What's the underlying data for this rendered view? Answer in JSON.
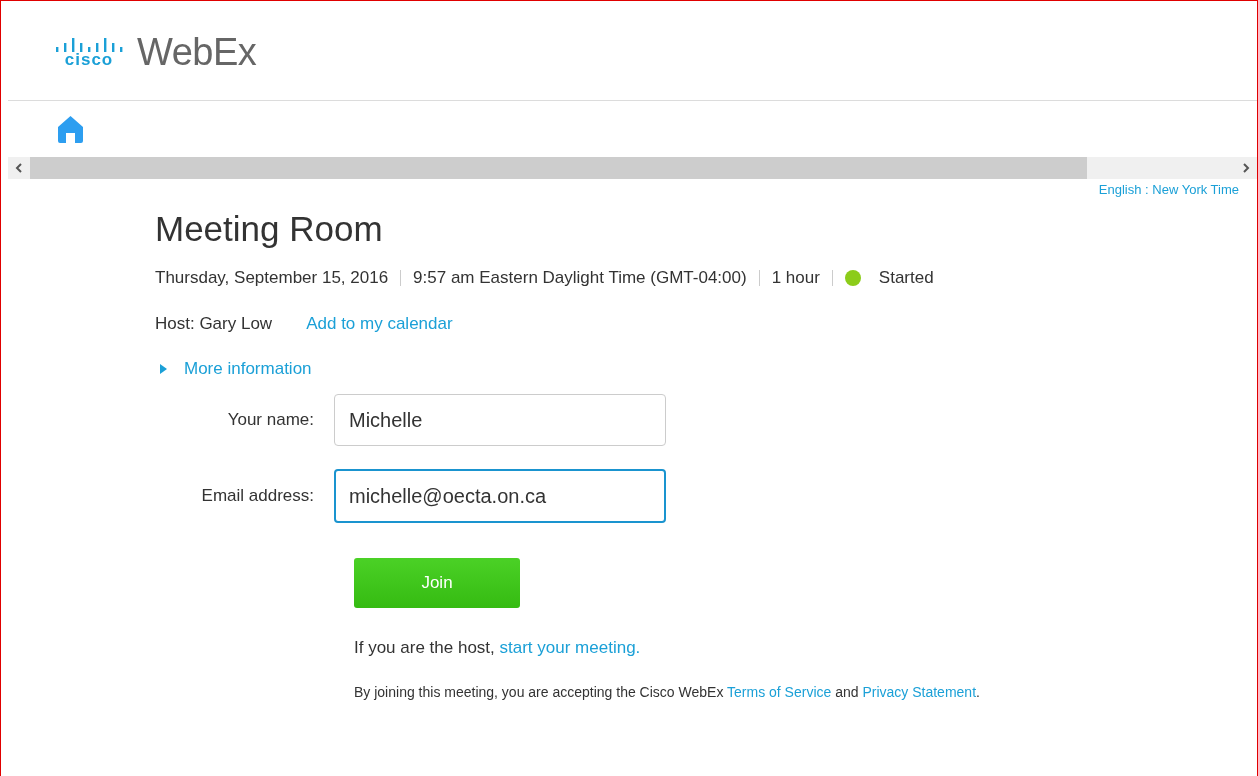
{
  "header": {
    "logo_mark": "cisco",
    "product": "WebEx"
  },
  "locale": "English : New York Time",
  "meeting": {
    "title": "Meeting Room",
    "details": [
      "Thursday, September 15, 2016",
      "9:57 am Eastern Daylight Time (GMT-04:00)",
      "1 hour"
    ],
    "status": {
      "label": "Started",
      "color": "#8ccc1a"
    },
    "host": "Host: Gary Low",
    "calendar_link": "Add to my calendar",
    "more_info": {
      "label": "More information",
      "expanded": false
    }
  },
  "form": {
    "fields": [
      {
        "label": "Your name:",
        "value": "Michelle",
        "focused": false
      },
      {
        "label": "Email address:",
        "value": "michelle@oecta.on.ca",
        "focused": true
      }
    ],
    "join_button": "Join",
    "host_note": {
      "text": "If you are the host, ",
      "link": "start your meeting."
    },
    "terms": {
      "prefix": "By joining this meeting, you are accepting the Cisco WebEx ",
      "terms_link": "Terms of Service",
      "middle": " and ",
      "privacy_link": "Privacy Statement",
      "suffix": "."
    }
  }
}
